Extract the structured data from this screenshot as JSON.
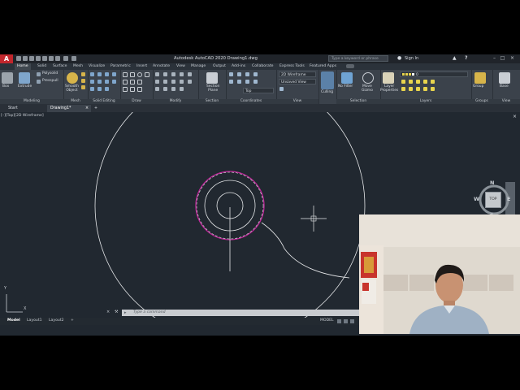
{
  "app": {
    "window_title": "Autodesk AutoCAD 2020   Drawing1.dwg",
    "logo_letter": "A",
    "search_placeholder": "Type a keyword or phrase",
    "sign_in": "Sign In",
    "help": "?"
  },
  "ribbon_tabs": [
    "Home",
    "Solid",
    "Surface",
    "Mesh",
    "Visualize",
    "Parametric",
    "Insert",
    "Annotate",
    "View",
    "Manage",
    "Output",
    "Add-ins",
    "Collaborate",
    "Express Tools",
    "Featured Apps"
  ],
  "active_ribbon_tab": "Home",
  "ribbon": {
    "modeling": {
      "label": "Modeling",
      "box": "Box",
      "extrude": "Extrude",
      "polysolid": "Polysolid",
      "presspull": "Presspull"
    },
    "mesh": {
      "label": "Mesh",
      "smooth_object": "Smooth\nObject"
    },
    "solid_editing": {
      "label": "Solid Editing"
    },
    "draw": {
      "label": "Draw"
    },
    "modify": {
      "label": "Modify"
    },
    "section": {
      "label": "Section",
      "section_plane": "Section\nPlane"
    },
    "coordinates": {
      "label": "Coordinates",
      "ucs_value": "Top"
    },
    "view": {
      "label": "View",
      "visual_style": "2D Wireframe",
      "saved_view": "Unsaved View"
    },
    "culling": {
      "label": "Culling"
    },
    "selection": {
      "label": "Selection",
      "no_filter": "No Filter",
      "move_gizmo": "Move\nGizmo"
    },
    "layers": {
      "label": "Layers",
      "layer_properties": "Layer\nProperties",
      "current_layer": "0"
    },
    "groups": {
      "label": "Groups",
      "group": "Group"
    },
    "view2": {
      "label": "View",
      "base": "Base"
    }
  },
  "file_tabs": [
    {
      "label": "Start"
    },
    {
      "label": "Drawing1*",
      "close": "×"
    },
    {
      "label": "+"
    }
  ],
  "viewport_label": "[–][Top][2D Wireframe]",
  "navcube": {
    "top": "TOP",
    "n": "N",
    "s": "S",
    "e": "E",
    "w": "W",
    "ucs_badge": "Unnamed"
  },
  "ucs_icon": {
    "x": "X",
    "y": "Y"
  },
  "command_line": {
    "placeholder": "Type a command"
  },
  "layout_tabs": [
    "Model",
    "Layout1",
    "Layout2",
    "+"
  ],
  "active_layout": "Model",
  "status_model": "MODEL",
  "colors": {
    "canvas_bg": "#212830",
    "ribbon_bg": "#3b424b",
    "logo_red": "#c1272d",
    "highlight_magenta": "#c0269a",
    "geometry": "#e6e8ea"
  }
}
